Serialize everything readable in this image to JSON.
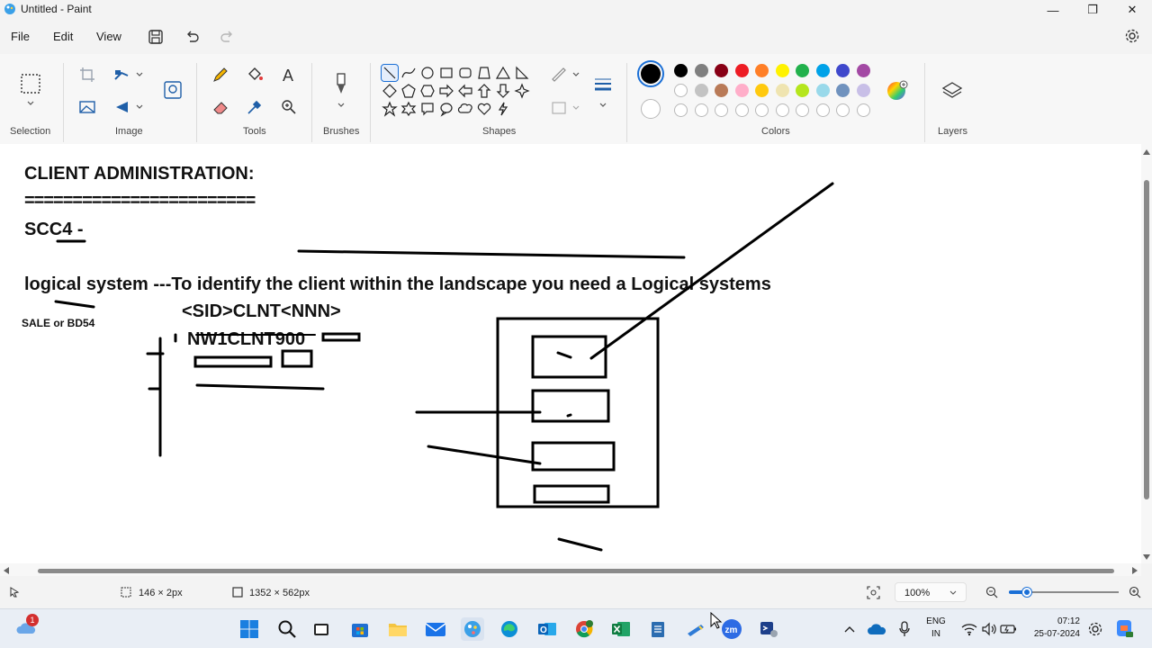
{
  "window": {
    "title": "Untitled - Paint",
    "minimize_glyph": "—",
    "maximize_glyph": "❐",
    "close_glyph": "✕"
  },
  "menu": {
    "items": [
      "File",
      "Edit",
      "View"
    ]
  },
  "ribbon": {
    "groups": {
      "selection": "Selection",
      "image": "Image",
      "tools": "Tools",
      "brushes": "Brushes",
      "shapes": "Shapes",
      "colors": "Colors",
      "layers": "Layers"
    },
    "primary_color": "#000000",
    "secondary_color": "#ffffff",
    "palette_row1": [
      "#000000",
      "#7f7f7f",
      "#880015",
      "#ed1c24",
      "#ff7f27",
      "#fff200",
      "#22b14c",
      "#00a2e8",
      "#3f48cc",
      "#a349a4"
    ],
    "palette_row2": [
      "#ffffff",
      "#c3c3c3",
      "#b97a57",
      "#ffaec9",
      "#ffc90e",
      "#efe4b0",
      "#b5e61d",
      "#99d9ea",
      "#7092be",
      "#c8bfe7"
    ]
  },
  "canvas": {
    "lines": [
      "CLIENT ADMINISTRATION:",
      "========================",
      "SCC4 -",
      "logical system ---To identify the client within the landscape you need a Logical systems",
      "SALE or BD54",
      "<SID>CLNT<NNN>",
      "NW1CLNT900"
    ]
  },
  "status": {
    "selection_size": "146 × 2px",
    "canvas_size": "1352 × 562px",
    "zoom": "100%"
  },
  "taskbar": {
    "language_top": "ENG",
    "language_bottom": "IN",
    "time": "07:12",
    "date": "25-07-2024",
    "notification_count": "1"
  }
}
